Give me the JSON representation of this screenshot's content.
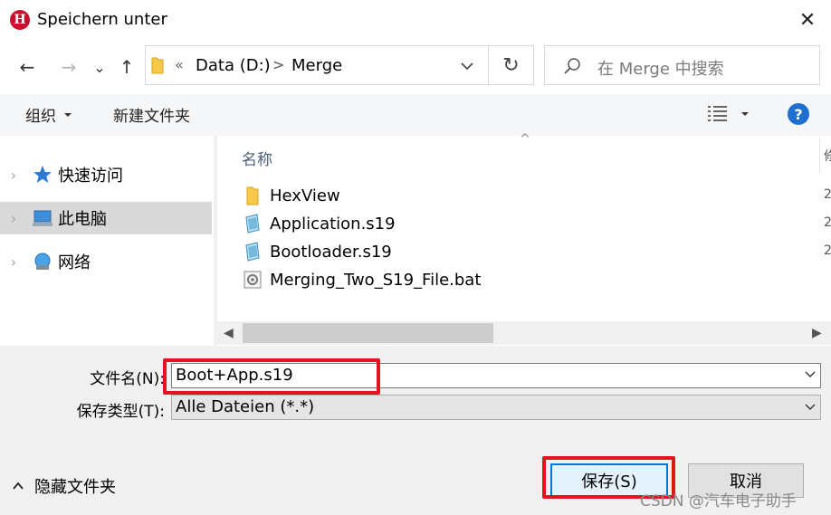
{
  "window": {
    "title": "Speichern unter",
    "logo_letter": "H",
    "close_glyph": "✕"
  },
  "nav": {
    "back_icon": "←",
    "forward_icon": "→",
    "recent_icon": "⌄",
    "up_icon": "↑",
    "breadcrumb_prefix": "«",
    "breadcrumb": [
      "Data (D:)",
      "Merge"
    ],
    "breadcrumb_sep": ">",
    "refresh_icon": "↻",
    "search_placeholder": "在 Merge 中搜索"
  },
  "toolbar": {
    "organize_label": "组织",
    "new_folder_label": "新建文件夹",
    "help_label": "?"
  },
  "navpane": {
    "items": [
      {
        "label": "快速访问",
        "icon": "star-icon",
        "selected": false
      },
      {
        "label": "此电脑",
        "icon": "computer-icon",
        "selected": true
      },
      {
        "label": "网络",
        "icon": "network-icon",
        "selected": false
      }
    ]
  },
  "files": {
    "column_name": "名称",
    "items": [
      {
        "name": "HexView",
        "type": "folder"
      },
      {
        "name": "Application.s19",
        "type": "s19"
      },
      {
        "name": "Bootloader.s19",
        "type": "s19"
      },
      {
        "name": "Merging_Two_S19_File.bat",
        "type": "bat"
      }
    ],
    "right_cut_glyphs": [
      "修",
      "2",
      "2",
      "2"
    ]
  },
  "form": {
    "filename_label": "文件名(N):",
    "filename_value": "Boot+App.s19",
    "filetype_label": "保存类型(T):",
    "filetype_value": "Alle Dateien (*.*)"
  },
  "footer": {
    "hide_folders_label": "隐藏文件夹",
    "save_label": "保存(S)",
    "cancel_label": "取消",
    "watermark": "CSDN @汽车电子助手"
  },
  "colors": {
    "highlight_red": "#e5121f",
    "accent_blue": "#0078d7",
    "help_blue": "#1f6fd1"
  }
}
